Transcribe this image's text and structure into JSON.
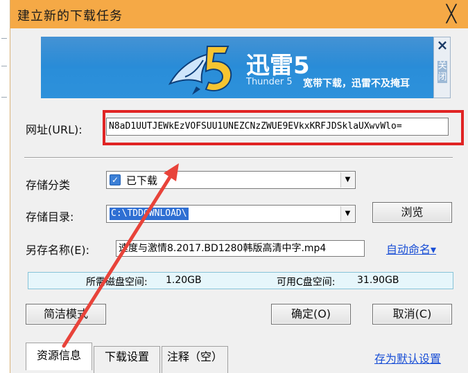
{
  "window": {
    "title": "建立新的下载任务",
    "close_glyph": "╳"
  },
  "banner": {
    "logo": "thunder-5-logo",
    "brand_title": "迅雷5",
    "brand_sub": "Thunder 5",
    "slogan": "宽带下载，迅雷不及掩耳",
    "side_close_x": "×",
    "side_close_text": "关闭"
  },
  "url": {
    "label": "网址(URL):",
    "value": "N8aD1UUTJEWkEzVOFSUU1UNEZCNzZWUE9EVkxKRFJDSklaUXwvWlo="
  },
  "category": {
    "label": "存储分类",
    "value": "已下载",
    "checkbox_icon": "checkbox-icon"
  },
  "directory": {
    "label": "存储目录:",
    "value": "C:\\TDDOWNLOAD\\",
    "browse_label": "浏览"
  },
  "save_as": {
    "label": "另存名称(E):",
    "value": "速度与激情8.2017.BD1280韩版高清中字.mp4",
    "auto_name_label": "自动命名▾"
  },
  "disk": {
    "required_label": "所需磁盘空间:",
    "required_value": "1.20GB",
    "available_label": "可用C盘空间:",
    "available_value": "31.90GB"
  },
  "buttons": {
    "simple_mode": "简洁模式",
    "ok": "确定(O)",
    "cancel": "取消(C)"
  },
  "tabs": [
    {
      "label": "资源信息",
      "active": true
    },
    {
      "label": "下载设置",
      "active": false
    },
    {
      "label": "注释（空）",
      "active": false
    }
  ],
  "save_default_label": "存为默认设置",
  "colors": {
    "titlebar": "#f5a946",
    "banner": "#2a8ed9",
    "highlight_box": "#e02424",
    "annotation_arrow": "#e8433a",
    "link": "#1a4fd6"
  }
}
